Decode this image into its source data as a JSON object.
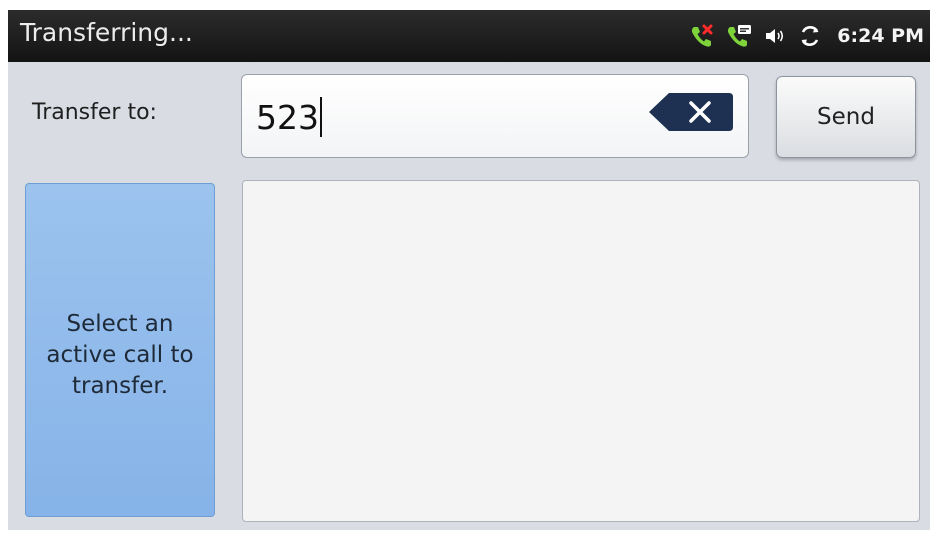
{
  "status_bar": {
    "title": "Transferring...",
    "time": "6:24 PM",
    "icons": [
      "missed-call-icon",
      "voicemail-icon",
      "volume-icon",
      "sync-icon"
    ]
  },
  "transfer": {
    "label": "Transfer to:",
    "number": "523",
    "send_label": "Send"
  },
  "call_select": {
    "message": "Select an active call to transfer."
  },
  "colors": {
    "status_bar_bg": "#1a1a1a",
    "screen_bg": "#d9dde3",
    "select_panel_bg": "#92bbeb",
    "clear_button_bg": "#1e3050"
  }
}
